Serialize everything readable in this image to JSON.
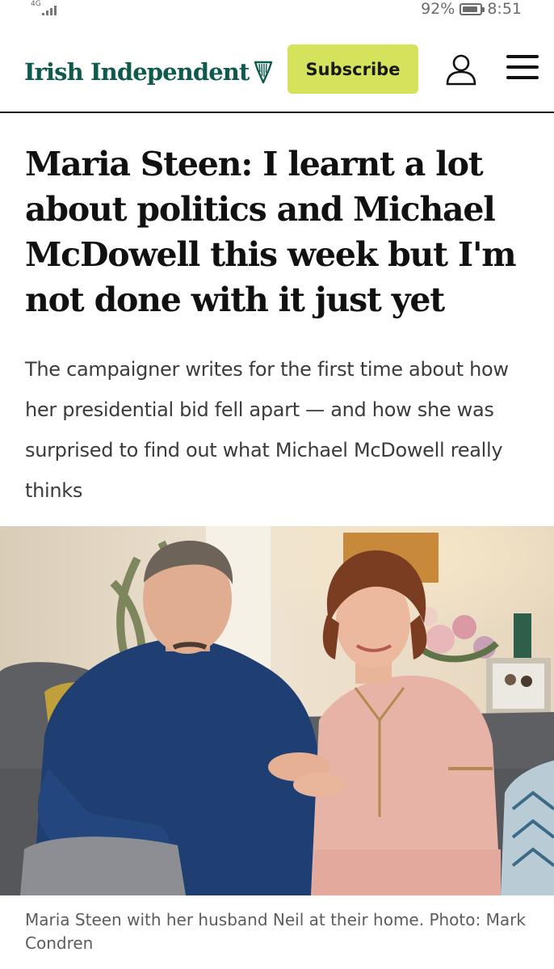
{
  "status_bar": {
    "network": "4G",
    "battery_percent": "92%",
    "time": "8:51",
    "battery_level": 0.92
  },
  "header": {
    "logo_text": "Irish Independent",
    "logo_icon": "harp-icon",
    "subscribe_label": "Subscribe",
    "account_icon": "user-account-icon",
    "menu_icon": "hamburger-menu-icon",
    "colors": {
      "brand": "#0e5a4d",
      "subscribe_bg": "#d5e35c"
    }
  },
  "article": {
    "headline": "Maria Steen: I learnt a lot about politics and Michael McDowell this week but I'm not done with it just yet",
    "standfirst": "The campaigner writes for the first time about how her presidential bid fell apart — and how she was surprised to find out what Michael McDowell really thinks",
    "image_caption": "Maria Steen with her husband Neil at their home. Photo: Mark Condren"
  }
}
